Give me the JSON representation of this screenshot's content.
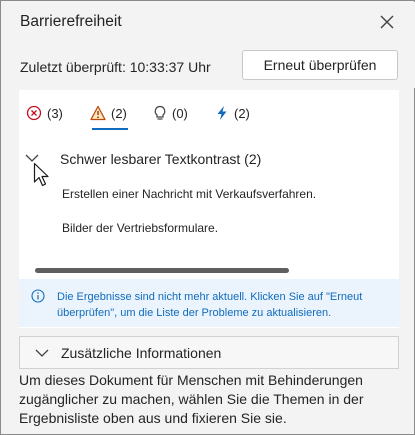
{
  "header": {
    "title": "Barrierefreiheit",
    "close_icon": "close-icon"
  },
  "status": {
    "last_checked": "Zuletzt überprüft: 10:33:37 Uhr",
    "recheck_label": "Erneut überprüfen"
  },
  "tabs": [
    {
      "icon": "error-circle-icon",
      "count": "(3)",
      "color": "#c50f1f"
    },
    {
      "icon": "warning-triangle-icon",
      "count": "(2)",
      "color": "#bc4b09",
      "selected": true
    },
    {
      "icon": "lightbulb-icon",
      "count": "(0)",
      "color": "#424242"
    },
    {
      "icon": "lightning-icon",
      "count": "(2)",
      "color": "#0f6cbd"
    }
  ],
  "group": {
    "title": "Schwer lesbarer Textkontrast (2)",
    "expanded": true,
    "items": [
      "Erstellen einer Nachricht mit Verkaufsverfahren.",
      "Bilder der Vertriebsformulare."
    ]
  },
  "info": {
    "text": "Die Ergebnisse sind nicht mehr aktuell. Klicken Sie auf \"Erneut überprüfen\", um die Liste der Probleme zu aktualisieren.",
    "icon": "info-icon"
  },
  "more_info": {
    "label": "Zusätzliche Informationen"
  },
  "description": "Um dieses Dokument für Menschen mit Behinderungen zugänglicher zu machen, wählen Sie die Themen in der Ergebnisliste oben aus und fixieren Sie sie.",
  "colors": {
    "accent": "#0f6cbd",
    "info_background": "#ebf3fc",
    "panel_background": "#f3f3f3"
  }
}
